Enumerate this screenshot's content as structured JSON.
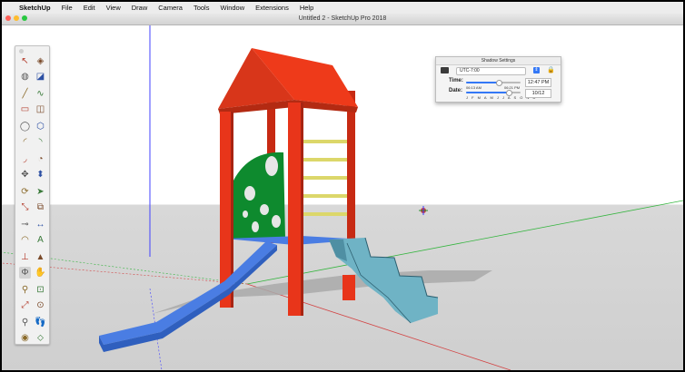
{
  "menubar": {
    "apple_icon": "",
    "app_name": "SketchUp",
    "items": [
      "File",
      "Edit",
      "View",
      "Draw",
      "Camera",
      "Tools",
      "Window",
      "Extensions",
      "Help"
    ]
  },
  "window": {
    "title": "Untitled 2 - SketchUp Pro 2018",
    "controls": {
      "close_color": "#fe5f57",
      "minimize_color": "#febc2e",
      "zoom_color": "#28c840"
    }
  },
  "viewport": {
    "sky_color": "#ffffff",
    "ground_color": "#d6d6d6",
    "axis_colors": {
      "red": "#d24545",
      "green": "#35b53f",
      "blue": "#4040ff"
    },
    "model": {
      "roof_color": "#ee3a1a",
      "post_color": "#e8351a",
      "panel_color": "#0e8a2e",
      "rung_color": "#dcd76a",
      "slide_color": "#4a7de3",
      "stairs_color": "#6fb3c5",
      "platform_color": "#4a7de3"
    }
  },
  "toolbar": {
    "tools": [
      {
        "name": "select-tool-icon",
        "glyph": "↖"
      },
      {
        "name": "make-component-icon",
        "glyph": "◈"
      },
      {
        "name": "paint-bucket-icon",
        "glyph": "◍"
      },
      {
        "name": "eraser-icon",
        "glyph": "◪"
      },
      {
        "name": "line-tool-icon",
        "glyph": "╱"
      },
      {
        "name": "freehand-tool-icon",
        "glyph": "∿"
      },
      {
        "name": "rectangle-tool-icon",
        "glyph": "▭"
      },
      {
        "name": "rotated-rectangle-icon",
        "glyph": "◫"
      },
      {
        "name": "circle-tool-icon",
        "glyph": "◯"
      },
      {
        "name": "polygon-tool-icon",
        "glyph": "⬡"
      },
      {
        "name": "arc-tool-icon",
        "glyph": "◜"
      },
      {
        "name": "two-point-arc-icon",
        "glyph": "◝"
      },
      {
        "name": "three-point-arc-icon",
        "glyph": "◞"
      },
      {
        "name": "pie-tool-icon",
        "glyph": "◔"
      },
      {
        "name": "move-tool-icon",
        "glyph": "✥"
      },
      {
        "name": "push-pull-icon",
        "glyph": "⬍"
      },
      {
        "name": "rotate-tool-icon",
        "glyph": "⟳"
      },
      {
        "name": "follow-me-icon",
        "glyph": "➤"
      },
      {
        "name": "scale-tool-icon",
        "glyph": "⤡"
      },
      {
        "name": "offset-tool-icon",
        "glyph": "⧉"
      },
      {
        "name": "tape-measure-icon",
        "glyph": "⊸"
      },
      {
        "name": "dimension-tool-icon",
        "glyph": "↔"
      },
      {
        "name": "protractor-icon",
        "glyph": "◠"
      },
      {
        "name": "text-tool-icon",
        "glyph": "A"
      },
      {
        "name": "axes-tool-icon",
        "glyph": "⊥"
      },
      {
        "name": "3d-text-icon",
        "glyph": "▲"
      },
      {
        "name": "orbit-tool-icon",
        "glyph": "Φ"
      },
      {
        "name": "pan-tool-icon",
        "glyph": "✋"
      },
      {
        "name": "zoom-tool-icon",
        "glyph": "⚲"
      },
      {
        "name": "zoom-window-icon",
        "glyph": "⊡"
      },
      {
        "name": "zoom-extents-icon",
        "glyph": "⤢"
      },
      {
        "name": "previous-view-icon",
        "glyph": "⊙"
      },
      {
        "name": "position-camera-icon",
        "glyph": "⚲"
      },
      {
        "name": "walk-tool-icon",
        "glyph": "👣"
      },
      {
        "name": "look-around-icon",
        "glyph": "◉"
      },
      {
        "name": "section-plane-icon",
        "glyph": "⬦"
      }
    ],
    "selected_index": 26
  },
  "shadow_settings": {
    "title": "Shadow Settings",
    "timezone": "UTC-7:00",
    "time_label": "Time:",
    "date_label": "Date:",
    "sunrise": "06:13 AM",
    "sunset": "06:21 PM",
    "time_value": "12:47 PM",
    "date_value": "10/12",
    "time_fraction": 0.6,
    "date_fraction": 0.78,
    "months": "J F M A M J J A S O N D"
  }
}
